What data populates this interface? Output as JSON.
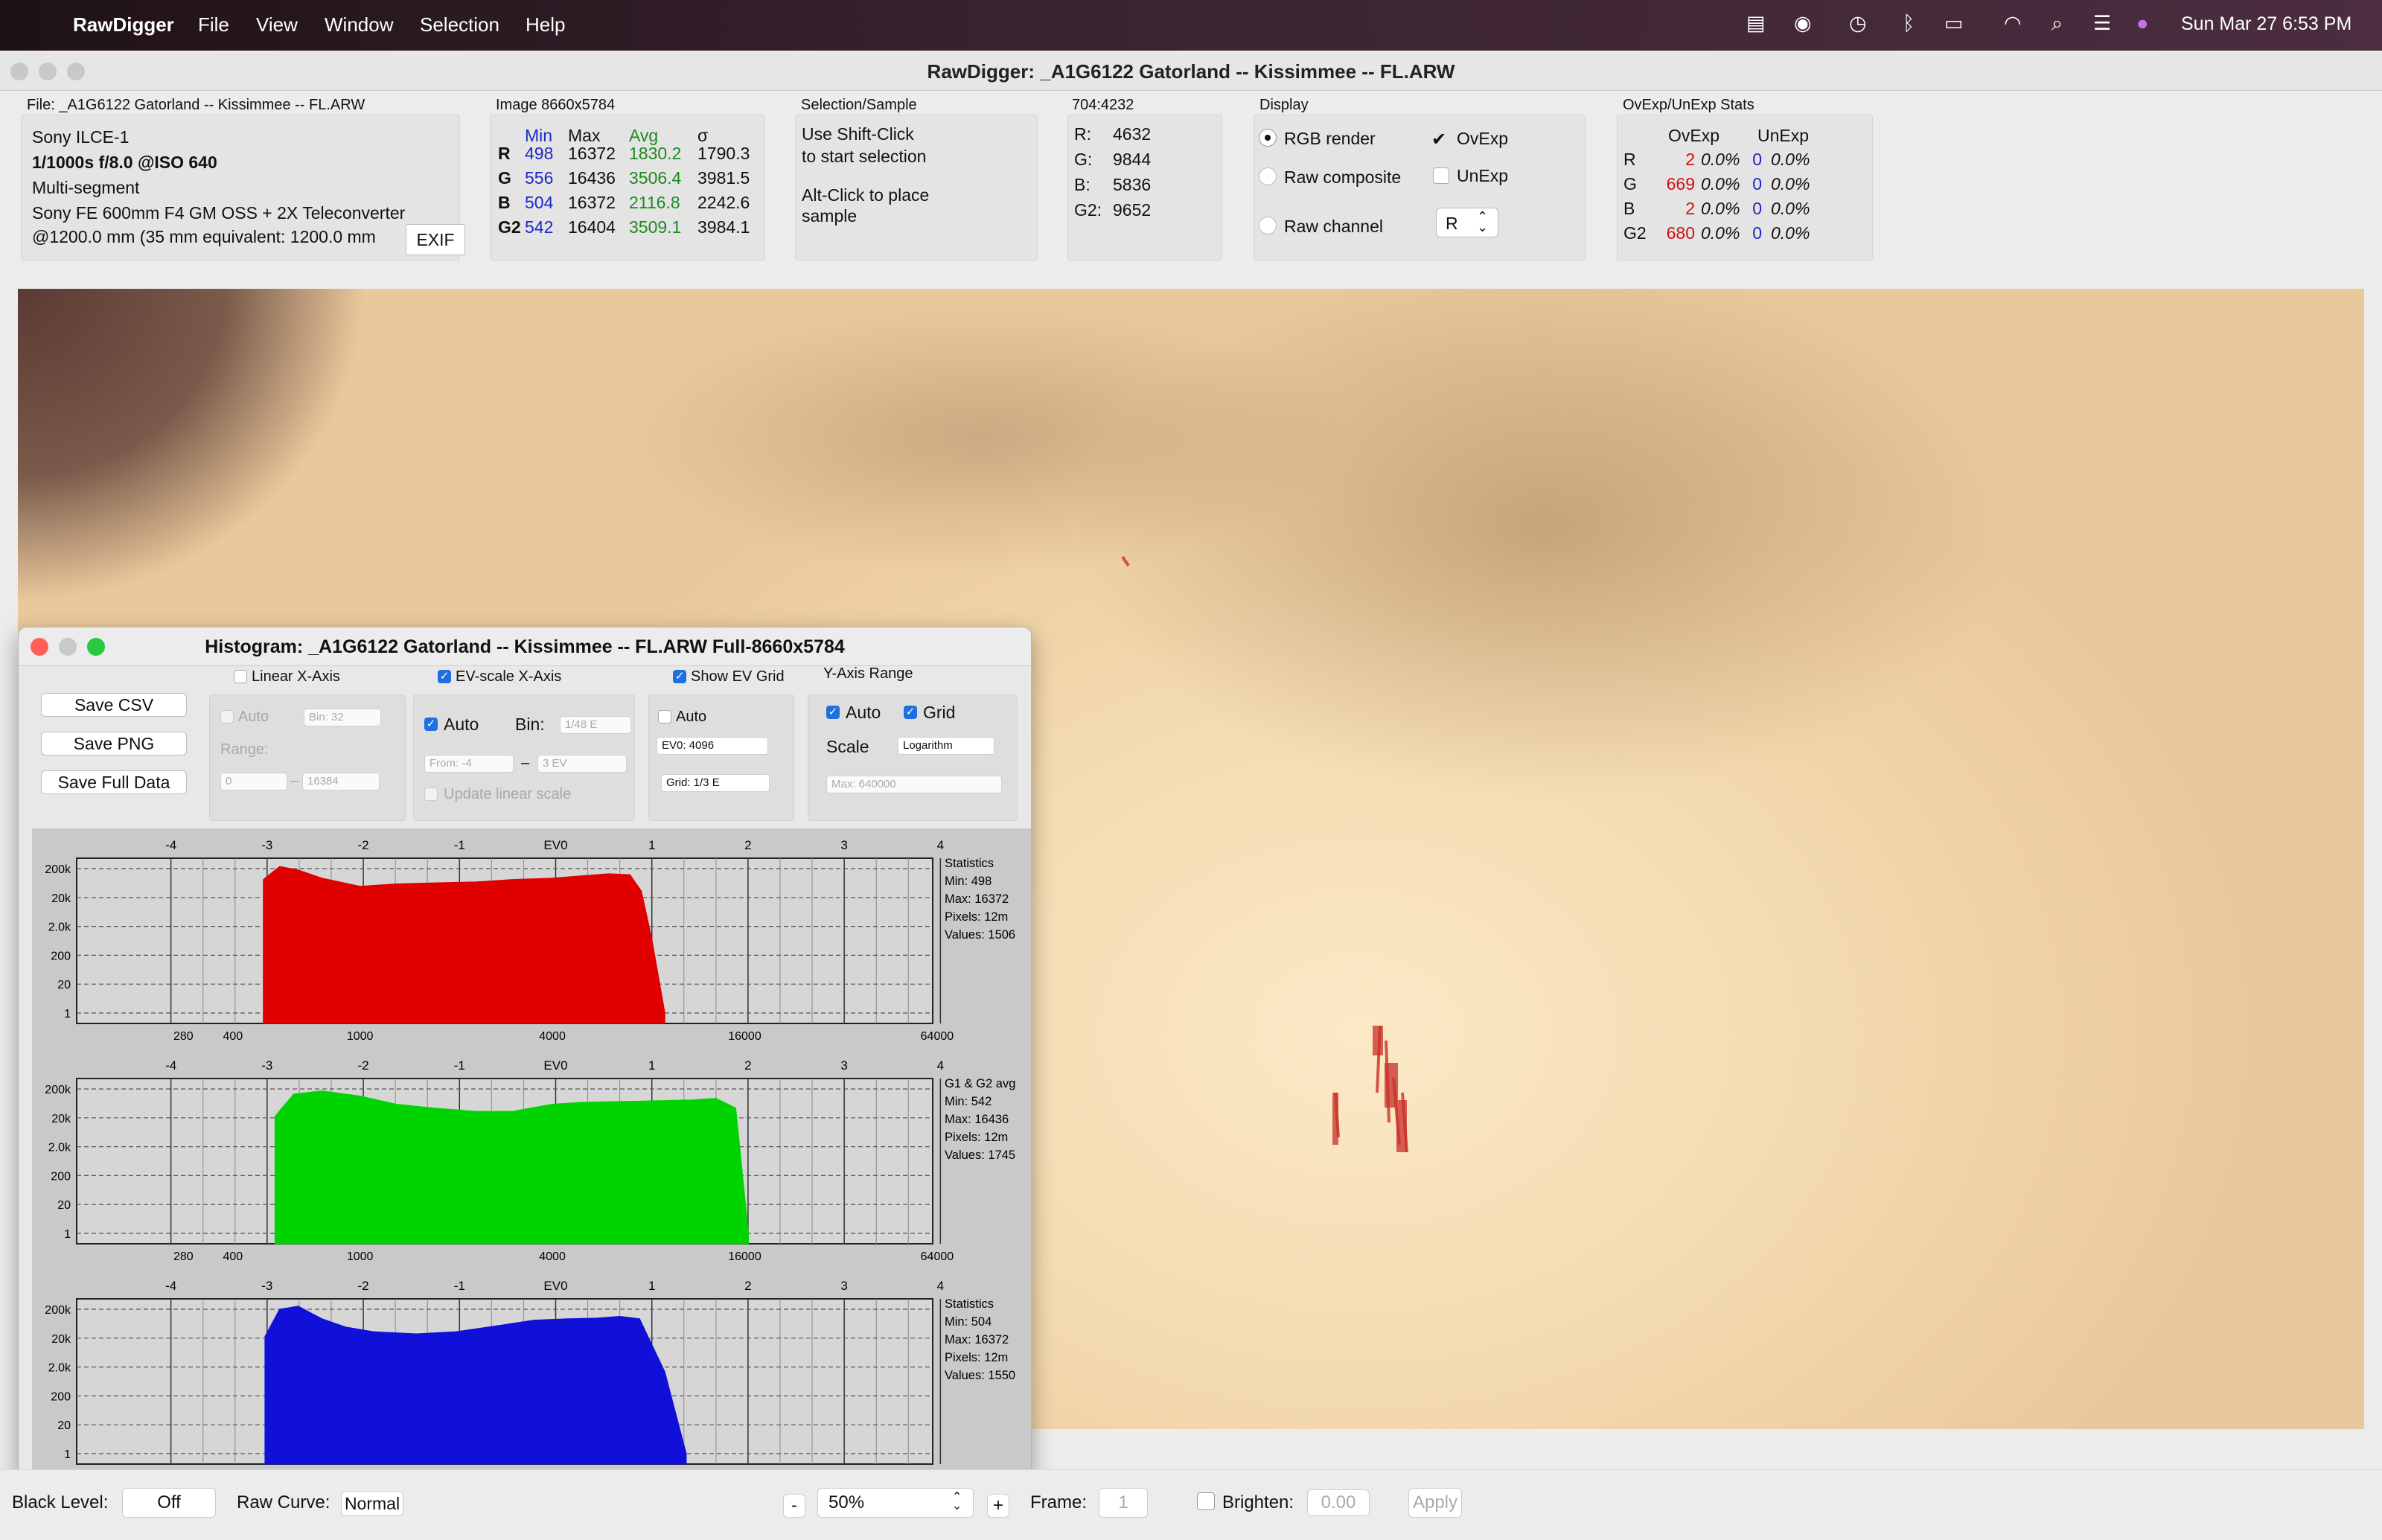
{
  "menubar": {
    "app": "RawDigger",
    "items": [
      "File",
      "View",
      "Window",
      "Selection",
      "Help"
    ],
    "clock": "Sun Mar 27  6:53 PM"
  },
  "window": {
    "title": "RawDigger: _A1G6122 Gatorland -- Kissimmee -- FL.ARW"
  },
  "info": {
    "file_label": "File: _A1G6122 Gatorland -- Kissimmee -- FL.ARW",
    "lines": [
      "Sony ILCE-1",
      "1/1000s f/8.0 @ISO 640",
      "Multi-segment",
      "Sony FE 600mm F4 GM OSS + 2X Teleconverter",
      "@1200.0 mm (35 mm equivalent: 1200.0 mm"
    ],
    "exif_button": "EXIF"
  },
  "image_stats": {
    "title": "Image 8660x5784",
    "headers": [
      "Min",
      "Max",
      "Avg",
      "σ"
    ],
    "rows": [
      {
        "ch": "R",
        "min": "498",
        "max": "16372",
        "avg": "1830.2",
        "sd": "1790.3"
      },
      {
        "ch": "G",
        "min": "556",
        "max": "16436",
        "avg": "3506.4",
        "sd": "3981.5"
      },
      {
        "ch": "B",
        "min": "504",
        "max": "16372",
        "avg": "2116.8",
        "sd": "2242.6"
      },
      {
        "ch": "G2",
        "min": "542",
        "max": "16404",
        "avg": "3509.1",
        "sd": "3984.1"
      }
    ]
  },
  "selection": {
    "title": "Selection/Sample",
    "line1": "Use Shift-Click",
    "line2": "to start selection",
    "line3": "Alt-Click to place",
    "line4": "sample"
  },
  "sample": {
    "title": "704:4232",
    "rows": [
      {
        "k": "R:",
        "v": "4632"
      },
      {
        "k": "G:",
        "v": "9844"
      },
      {
        "k": "B:",
        "v": "5836"
      },
      {
        "k": "G2:",
        "v": "9652"
      }
    ]
  },
  "display": {
    "title": "Display",
    "rgb_render": "RGB render",
    "raw_composite": "Raw composite",
    "raw_channel": "Raw channel",
    "ovexp": "OvExp",
    "unexp": "UnExp",
    "channel_select": "R"
  },
  "ovexp_stats": {
    "title": "OvExp/UnExp Stats",
    "headers": [
      "OvExp",
      "UnExp"
    ],
    "rows": [
      {
        "ch": "R",
        "ov": "2",
        "ovp": "0.0%",
        "un": "0",
        "unp": "0.0%"
      },
      {
        "ch": "G",
        "ov": "669",
        "ovp": "0.0%",
        "un": "0",
        "unp": "0.0%"
      },
      {
        "ch": "B",
        "ov": "2",
        "ovp": "0.0%",
        "un": "0",
        "unp": "0.0%"
      },
      {
        "ch": "G2",
        "ov": "680",
        "ovp": "0.0%",
        "un": "0",
        "unp": "0.0%"
      }
    ]
  },
  "histogram": {
    "title": "Histogram: _A1G6122 Gatorland -- Kissimmee -- FL.ARW Full-8660x5784",
    "buttons": [
      "Save CSV",
      "Save PNG",
      "Save Full Data"
    ],
    "linear": {
      "label": "Linear X-Axis",
      "auto": "Auto",
      "bin": "Bin: 32",
      "range": "Range:",
      "from": "0",
      "to": "16384"
    },
    "evscale": {
      "label": "EV-scale X-Axis",
      "auto": "Auto",
      "bin_label": "Bin:",
      "bin": "1/48 E",
      "from": "From: -4",
      "to": "3 EV",
      "update": "Update linear scale"
    },
    "evgrid": {
      "label": "Show EV Grid",
      "auto": "Auto",
      "ev0": "EV0: 4096",
      "grid": "Grid: 1/3 E"
    },
    "yaxis": {
      "label": "Y-Axis Range",
      "auto": "Auto",
      "grid": "Grid",
      "scale": "Scale",
      "scale_value": "Logarithm",
      "max": "Max: 640000"
    },
    "x_top_labels": [
      "-4",
      "-3",
      "-2",
      "-1",
      "EV0",
      "1",
      "2",
      "3",
      "4"
    ],
    "x_bottom_labels": [
      "280",
      "400",
      "1000",
      "4000",
      "16000",
      "64000"
    ],
    "y_labels": [
      "200k",
      "20k",
      "2.0k",
      "200",
      "20",
      "1"
    ]
  },
  "chart_data": [
    {
      "type": "area",
      "title": "Statistics",
      "color": "#e00000",
      "stats": [
        "Min: 498",
        "Max: 16372",
        "Pixels: 12m",
        "Values: 1506"
      ],
      "xscale": "log2 (EV)",
      "yscale": "log",
      "x": [
        498,
        560,
        640,
        760,
        1000,
        1300,
        1700,
        2300,
        3000,
        4000,
        5000,
        6000,
        7000,
        7600,
        8200,
        9000
      ],
      "values": [
        80000,
        240000,
        180000,
        90000,
        45000,
        55000,
        60000,
        65000,
        80000,
        90000,
        110000,
        130000,
        120000,
        30000,
        500,
        1
      ]
    },
    {
      "type": "area",
      "title": "G1 & G2 avg",
      "color": "#00d400",
      "stats": [
        "Min: 542",
        "Max: 16436",
        "Pixels: 12m",
        "Values: 1745"
      ],
      "xscale": "log2 (EV)",
      "yscale": "log",
      "x": [
        542,
        620,
        760,
        1000,
        1300,
        1700,
        2300,
        3000,
        4000,
        5000,
        7000,
        9000,
        11000,
        13000,
        15000,
        16436
      ],
      "values": [
        20000,
        130000,
        170000,
        110000,
        55000,
        40000,
        30000,
        30000,
        55000,
        65000,
        70000,
        75000,
        80000,
        90000,
        40000,
        1
      ]
    },
    {
      "type": "area",
      "title": "Statistics",
      "color": "#1010d8",
      "stats": [
        "Min: 504",
        "Max: 16372",
        "Pixels: 12m",
        "Values: 1550"
      ],
      "xscale": "log2 (EV)",
      "yscale": "log",
      "x": [
        504,
        560,
        640,
        760,
        900,
        1100,
        1500,
        2000,
        2700,
        3500,
        4500,
        5500,
        6500,
        7500,
        9000,
        10500
      ],
      "values": [
        20000,
        200000,
        260000,
        90000,
        45000,
        30000,
        25000,
        30000,
        50000,
        80000,
        90000,
        95000,
        110000,
        90000,
        1000,
        1
      ]
    }
  ],
  "bottom": {
    "black_level_label": "Black Level:",
    "black_level": "Off",
    "raw_curve_label": "Raw Curve:",
    "raw_curve": "Normal",
    "minus": "-",
    "zoom": "50%",
    "plus": "+",
    "frame_label": "Frame:",
    "frame": "1",
    "brighten_label": "Brighten:",
    "brighten": "0.00",
    "apply": "Apply"
  }
}
